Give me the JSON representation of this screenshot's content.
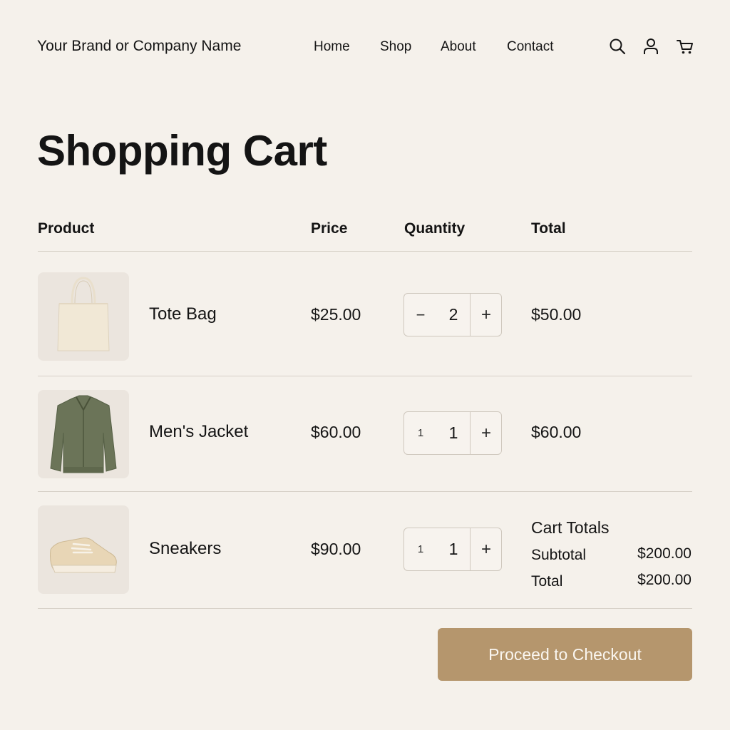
{
  "header": {
    "brand": "Your Brand or Company Name",
    "nav": [
      "Home",
      "Shop",
      "About",
      "Contact"
    ],
    "icons": [
      "search-icon",
      "account-icon",
      "cart-icon"
    ]
  },
  "page_title": "Shopping Cart",
  "table": {
    "columns": [
      "Product",
      "Price",
      "Quantity",
      "Total"
    ],
    "rows": [
      {
        "name": "Tote Bag",
        "price": "$25.00",
        "qty_minus": "−",
        "qty": "2",
        "qty_plus": "+",
        "total": "$50.00"
      },
      {
        "name": "Men's Jacket",
        "price": "$60.00",
        "qty_minus": "1",
        "qty": "1",
        "qty_plus": "+",
        "total": "$60.00"
      },
      {
        "name": "Sneakers",
        "price": "$90.00",
        "qty_minus": "1",
        "qty": "1",
        "qty_plus": "+",
        "total": ""
      }
    ]
  },
  "cart_totals": {
    "title": "Cart Totals",
    "subtotal_label": "Subtotal",
    "subtotal": "$200.00",
    "total_label": "Total",
    "total": "$200.00"
  },
  "checkout_label": "Proceed to Checkout",
  "colors": {
    "background": "#f5f1eb",
    "accent": "#b5966d",
    "divider": "#d6d0c7"
  }
}
